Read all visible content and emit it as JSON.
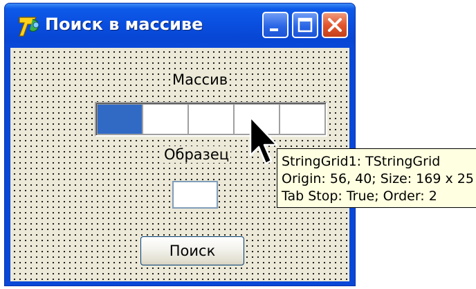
{
  "window": {
    "title": "Поиск в массиве",
    "app_icon": "delphi-7-icon",
    "title_color": "#0a49d8",
    "buttons": {
      "minimize_icon": "minimize-icon",
      "maximize_icon": "maximize-icon",
      "close_icon": "close-icon"
    }
  },
  "form": {
    "background": "#ece9d8",
    "array_label": "Массив",
    "sample_label": "Образец",
    "string_grid": {
      "columns": 5,
      "fixed_columns": 1,
      "fixed_color": "#316ac5",
      "cells": [
        "",
        "",
        "",
        "",
        ""
      ]
    },
    "sample_input_value": "",
    "search_button": "Поиск"
  },
  "tooltip": {
    "line1": "StringGrid1: TStringGrid",
    "line2": "Origin: 56, 40; Size: 169 x 25",
    "line3": "Tab Stop: True; Order: 2",
    "background": "#ffffe1"
  },
  "cursor": "arrow-cursor-icon"
}
